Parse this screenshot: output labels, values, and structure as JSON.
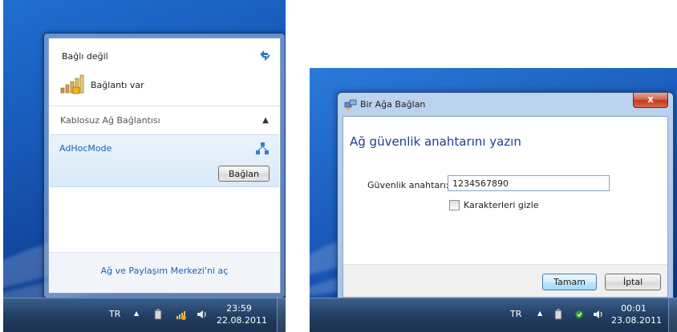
{
  "left_screenshot": {
    "flyout": {
      "status": "Bağlı değil",
      "access_status": "Bağlantı var",
      "section_title": "Kablosuz Ağ Bağlantısı",
      "network_name": "AdHocMode",
      "connect_button": "Bağlan",
      "footer_link": "Ağ ve Paylaşım Merkezi'ni aç"
    },
    "taskbar": {
      "language": "TR",
      "time": "23:59",
      "date": "22.08.2011"
    }
  },
  "right_screenshot": {
    "dialog": {
      "title": "Bir Ağa Bağlan",
      "close_glyph": "x",
      "heading": "Ağ güvenlik anahtarını yazın",
      "security_key_label": "Güvenlik anahtarı:",
      "security_key_value": "1234567890",
      "hide_characters_label": "Karakterleri gizle",
      "hide_characters_checked": false,
      "ok_button": "Tamam",
      "cancel_button": "İptal"
    },
    "taskbar": {
      "language": "TR",
      "time": "00:01",
      "date": "23.08.2011"
    }
  },
  "colors": {
    "desktop_blue": "#1859b7",
    "link_blue": "#1c5fb0",
    "heading_blue": "#1e3d8f",
    "close_red": "#c2391f"
  },
  "icons": [
    "refresh-icon",
    "signal-bars-icon",
    "adhoc-network-icon",
    "chevron-up-icon",
    "show-hidden-icons-arrow",
    "power-icon",
    "network-tray-icon",
    "volume-icon",
    "network-dialog-icon",
    "close-icon"
  ]
}
